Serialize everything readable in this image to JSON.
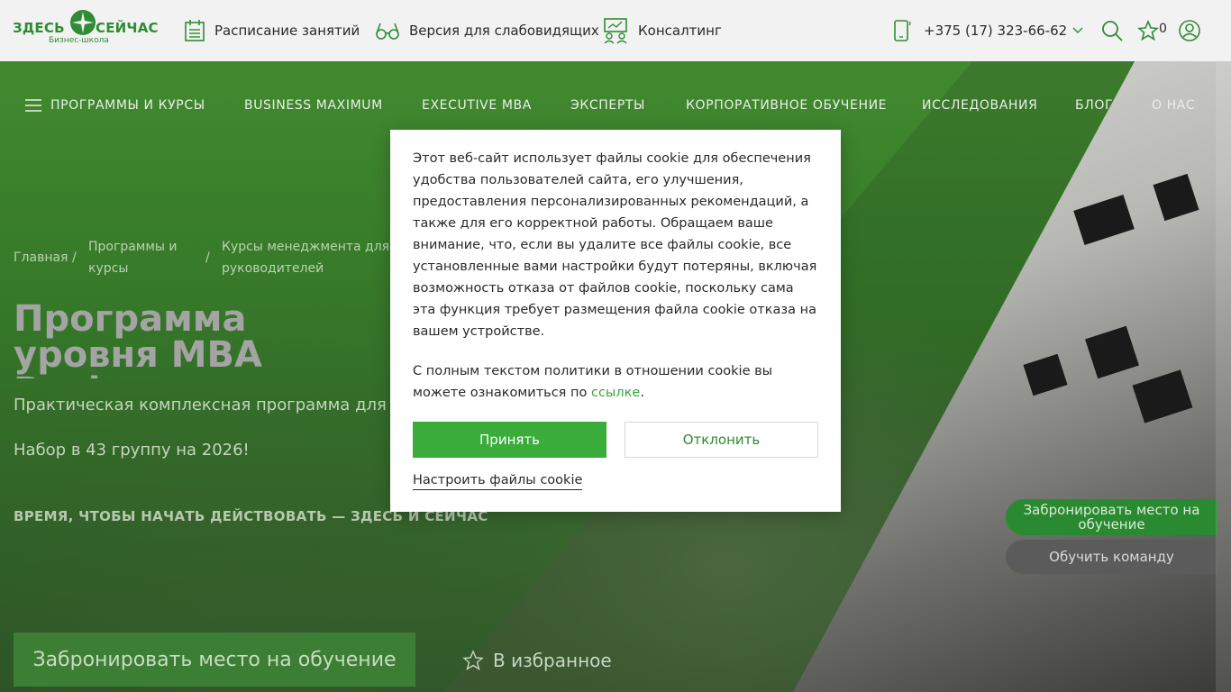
{
  "header": {
    "logo": {
      "word1": "ЗДЕСЬ",
      "word2": "СЕЙЧАС",
      "subtitle": "Бизнес-школа"
    },
    "nav": {
      "schedule": "Расписание занятий",
      "visually_impaired": "Версия для слабовидящих",
      "consulting": "Консалтинг"
    },
    "phone": "+375 (17) 323-66-62",
    "favorites_count": "0"
  },
  "main_nav": {
    "programs": "ПРОГРАММЫ И КУРСЫ",
    "business_maximum": "BUSINESS MAXIMUM",
    "executive_mba": "EXECUTIVE MBA",
    "experts": "ЭКСПЕРТЫ",
    "corporate": "КОРПОРАТИВНОЕ ОБУЧЕНИЕ",
    "research": "ИССЛЕДОВАНИЯ",
    "blog": "БЛОГ",
    "about": "О НАС"
  },
  "breadcrumb": {
    "home": "Главная",
    "programs": "Программы и курсы",
    "courses": "Курсы менеджмента для руководителей",
    "separator": "/"
  },
  "hero": {
    "title": "Программа уровня MBA Business Maximum",
    "subtitle": "Практическая комплексная программа для собственников",
    "recruitment": "Набор в 43 группу на 2026!",
    "slogan": "ВРЕМЯ, ЧТОБЫ НАЧАТЬ ДЕЙСТВОВАТЬ — ЗДЕСЬ И СЕЙЧАС",
    "book_button": "Забронировать место на обучение",
    "favorite_button": "В избранное"
  },
  "floating": {
    "book": "Забронировать место на обучение",
    "train_team": "Обучить команду"
  },
  "cookie": {
    "text": "Этот веб-сайт использует файлы cookie для обеспечения удобства пользователей сайта, его улучшения, предоставления персонализированных рекомендаций, а также для его корректной работы. Обращаем ваше внимание, что, если вы удалите все файлы cookie, все установленные вами настройки будут потеряны, включая возможность отказа от файлов cookie, поскольку сама эта функция требует размещения файла cookie отказа на вашем устройстве.",
    "policy_prefix": "С полным текстом политики в отношении cookie вы можете ознакомиться по",
    "policy_link": "ссылке",
    "policy_suffix": ".",
    "accept": "Принять",
    "decline": "Отклонить",
    "settings": "Настроить файлы cookie"
  },
  "colors": {
    "brand_green": "#2f8b34",
    "accept_green": "#39ac39",
    "link_green": "#3aa63a"
  }
}
